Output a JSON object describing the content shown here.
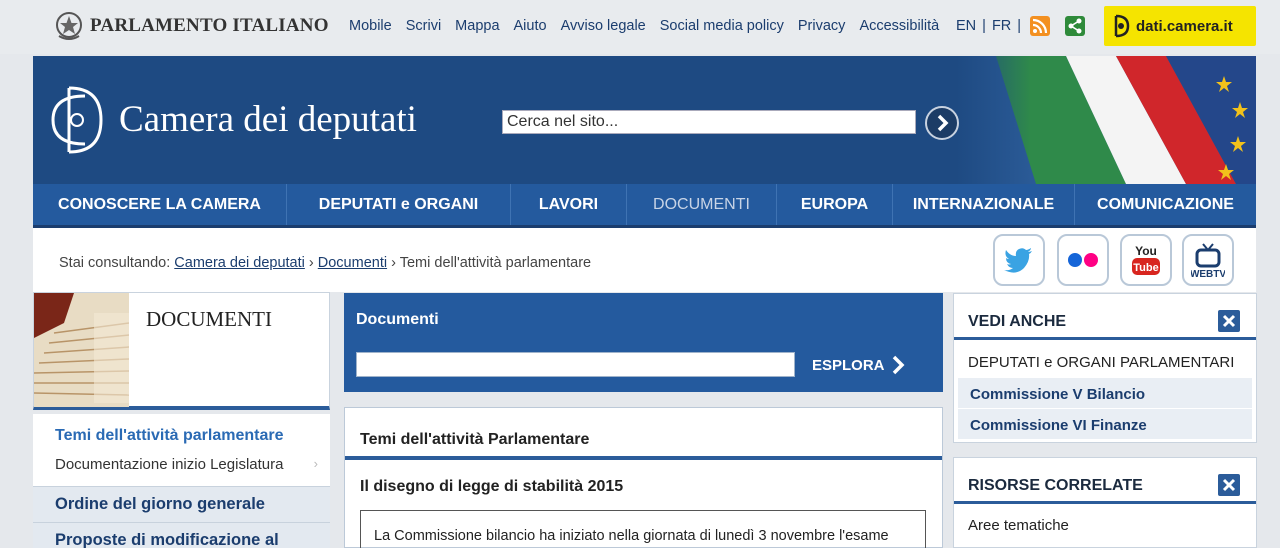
{
  "topbar": {
    "brand": "PARLAMENTO ITALIANO",
    "links": [
      "Mobile",
      "Scrivi",
      "Mappa",
      "Aiuto",
      "Avviso legale",
      "Social media policy",
      "Privacy",
      "Accessibilità"
    ],
    "lang": [
      "EN",
      "FR"
    ],
    "dati_label": "dati.camera.it",
    "icons": {
      "rss": "rss-icon",
      "share": "share-icon"
    }
  },
  "header": {
    "title": "Camera dei deputati",
    "search_value": "Cerca nel sito..."
  },
  "nav": {
    "items": [
      "CONOSCERE LA CAMERA",
      "DEPUTATI e ORGANI",
      "LAVORI",
      "DOCUMENTI",
      "EUROPA",
      "INTERNAZIONALE",
      "COMUNICAZIONE"
    ],
    "active": "DOCUMENTI"
  },
  "breadcrumb": {
    "prefix": "Stai consultando:",
    "links": [
      "Camera dei deputati",
      "Documenti"
    ],
    "current": "Temi dell'attività parlamentare"
  },
  "social": [
    "twitter-icon",
    "flickr-icon",
    "youtube-icon",
    "webtv-icon"
  ],
  "left": {
    "section_title": "DOCUMENTI",
    "active_item": "Temi dell'attività parlamentare",
    "sub_item": "Documentazione inizio Legislatura",
    "items": [
      "Ordine del giorno generale",
      "Proposte di modificazione al"
    ]
  },
  "center": {
    "panel_title": "Documenti",
    "explore_label": "ESPLORA",
    "section_heading": "Temi dell'attività Parlamentare",
    "sub_heading": "Il disegno di legge di stabilità 2015",
    "paragraph": "La Commissione bilancio ha iniziato nella giornata di lunedì 3 novembre l'esame"
  },
  "right": {
    "see_also": {
      "title": "VEDI ANCHE",
      "link": "DEPUTATI e ORGANI PARLAMENTARI",
      "sub": [
        "Commissione V Bilancio",
        "Commissione VI Finanze"
      ]
    },
    "related": {
      "title": "RISORSE CORRELATE",
      "link": "Aree tematiche"
    }
  },
  "colors": {
    "header_blue": "#1e4a82",
    "nav_blue": "#245a9e",
    "link_blue": "#1b3d6e",
    "accent_yellow": "#f5e400"
  }
}
